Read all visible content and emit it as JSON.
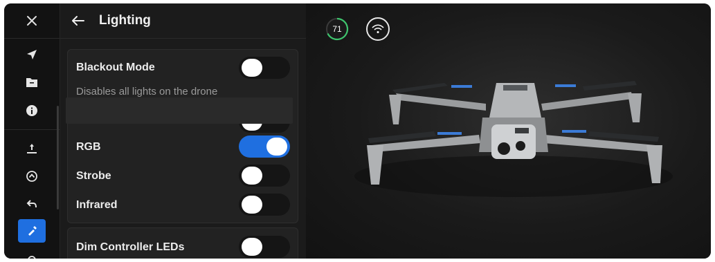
{
  "header": {
    "title": "Lighting"
  },
  "status": {
    "battery": "71"
  },
  "sections": {
    "blackout": {
      "label": "Blackout Mode",
      "description": "Disables all lights on the drone",
      "enabled": false
    },
    "lights": [
      {
        "label": "RGB",
        "enabled": true
      },
      {
        "label": "Strobe",
        "enabled": false
      },
      {
        "label": "Infrared",
        "enabled": false
      }
    ],
    "dim": {
      "label": "Dim Controller LEDs",
      "enabled": false
    }
  },
  "colors": {
    "accent": "#1f6fe0",
    "battery_ring": "#3ec46d",
    "background": "#141414"
  },
  "icons": {
    "rail": [
      "close-icon",
      "navigate-arrow-icon",
      "media-folder-icon",
      "info-icon",
      "takeoff-icon",
      "camera-orbit-icon",
      "return-home-icon",
      "flashlight-icon",
      "partial-settings-icon"
    ],
    "header": "back-arrow-icon",
    "status": [
      "battery-ring-icon",
      "wifi-icon"
    ]
  }
}
